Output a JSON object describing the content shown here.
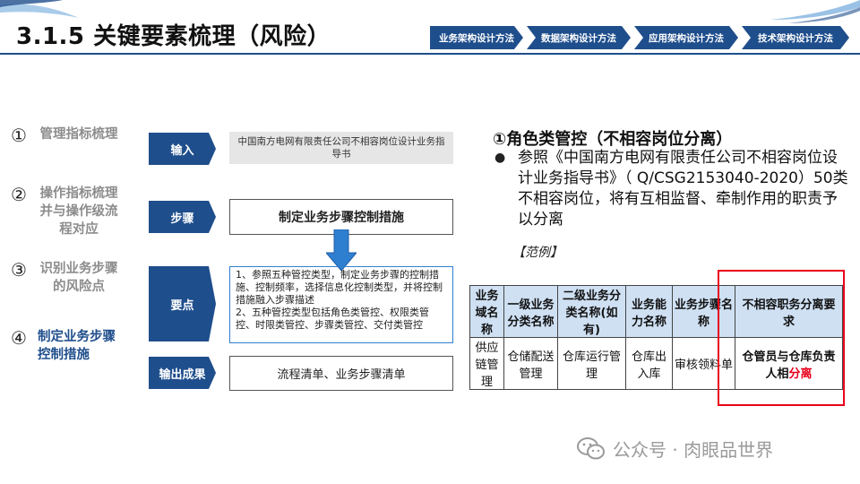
{
  "header": {
    "title": "3.1.5 关键要素梳理（风险）",
    "nav": [
      "业务架构设计方法",
      "数据架构设计方法",
      "应用架构设计方法",
      "技术架构设计方法"
    ]
  },
  "steps": [
    {
      "num": "①",
      "label": "管理指标梳理"
    },
    {
      "num": "②",
      "label": "操作指标梳理并与操作级流程对应"
    },
    {
      "num": "③",
      "label": "识别业务步骤的风险点"
    },
    {
      "num": "④",
      "label": "制定业务步骤控制措施"
    }
  ],
  "flow": {
    "input_label": "输入",
    "input_text": "中国南方电网有限责任公司不相容岗位设计业务指导书",
    "step_label": "步骤",
    "step_text": "制定业务步骤控制措施",
    "points_label": "要点",
    "points_line1": "1、参照五种管控类型，制定业务步骤的控制措施、控制频率，选择信息化控制类型，并将控制措施融入步骤描述",
    "points_line2": "2、五种管控类型包括角色类管控、权限类管控、时限类管控、步骤类管控、交付类管控",
    "output_label": "输出成果",
    "output_text": "流程清单、业务步骤清单"
  },
  "right": {
    "heading": "①角色类管控（不相容岗位分离）",
    "bullet": "参照《中国南方电网有限责任公司不相容岗位设计业务指导书》（ Q/CSG2153040-2020）50类不相容岗位，将有互相监督、牵制作用的职责予以分离",
    "example": "【范例】"
  },
  "table": {
    "headers": [
      "业务域名称",
      "一级业务分类名称",
      "二级业务分类名称(如有)",
      "业务能力名称",
      "业务步骤名称",
      "不相容职务分离要求"
    ],
    "row": [
      "供应链管理",
      "仓储配送管理",
      "仓库运行管理",
      "仓库出入库",
      "审核领料单"
    ],
    "req_prefix": "仓管员与仓库负责人相",
    "req_highlight": "分离"
  },
  "watermark": "公众号 · 肉眼品世界",
  "colors": {
    "primary": "#1f4e8c",
    "highlight": "#e8001b",
    "header_fill": "#cfe0f3",
    "input_fill": "#e6e6e6"
  }
}
